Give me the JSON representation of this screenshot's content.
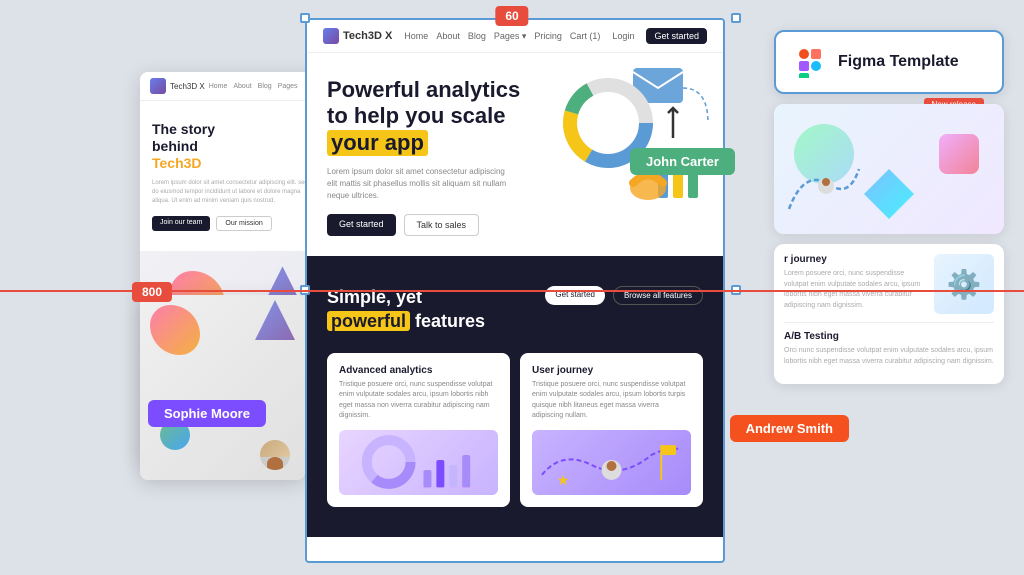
{
  "canvas": {
    "background": "#dde1e8"
  },
  "selection_badge": {
    "value": "60",
    "left_badge": "800"
  },
  "figma_card": {
    "icon": "🎨",
    "title": "Figma Template",
    "new_badge": "New release"
  },
  "main_site": {
    "logo": "Tech3D X",
    "nav_items": [
      "Home",
      "About",
      "Blog",
      "Pages",
      "Pricing",
      "Cart (1)"
    ],
    "login": "Login",
    "get_started": "Get started",
    "hero": {
      "title_line1": "Powerful analytics",
      "title_line2": "to help you scale",
      "title_highlight": "your app",
      "description": "Lorem ipsum dolor sit amet consectetur adipiscing elit mattis sit phasellus mollis sit aliquam sit nullam neque ultrices.",
      "btn_primary": "Get started",
      "btn_secondary": "Talk to sales"
    },
    "dark_section": {
      "title_line1": "Simple, yet",
      "title_highlight": "powerful",
      "title_line2": "features",
      "btn_primary": "Get started",
      "btn_secondary": "Browse all features",
      "card1": {
        "title": "Advanced analytics",
        "desc": "Tristique posuere orci, nunc suspendisse volutpat enim vulputate sodales arcu, ipsum lobortis nibh eget massa non viverra curabitur adipiscing nam dignissim."
      },
      "card2": {
        "title": "User journey",
        "desc": "Tristique posuere orci, nunc suspendisse volutpat enim vulputate sodales arcu, ipsum lobortis turpis quisque nibh litaneus eget massa viverra adipiscing nullam."
      }
    }
  },
  "left_mini_site": {
    "logo": "Tech3D X",
    "nav_items": [
      "Home",
      "About",
      "Blog",
      "Pages"
    ],
    "hero": {
      "title_line1": "The story",
      "title_line2": "behind",
      "title_highlight": "Tech3D",
      "description": "Lorem ipsum dolor sit amet consectetur adipiscing elit. sed do eiusmod tempor incididunt ut labore et dolore magna aliqua. Ut enim ad minim veniam quis nostrud.",
      "btn1": "Join our team",
      "btn2": "Our mission"
    }
  },
  "right_panel": {
    "journey_card": {
      "title": "r journey",
      "desc": "Lorem posuere orci, nunc suspendisse volutpat enim vulputate sodales arcu, ipsum lobortis nibh eget massa viverra curabitur adipiscing nam dignissim."
    },
    "ab_card": {
      "title": "A/B Testing",
      "desc": "Orci nunc suspendisse volutpat enim vulputate sodales arcu, ipsum lobortis nibh eget massa viverra curabitur adipiscing nam dignissim."
    }
  },
  "user_badges": {
    "john": "John Carter",
    "sophie": "Sophie Moore",
    "andrew": "Andrew Smith"
  }
}
